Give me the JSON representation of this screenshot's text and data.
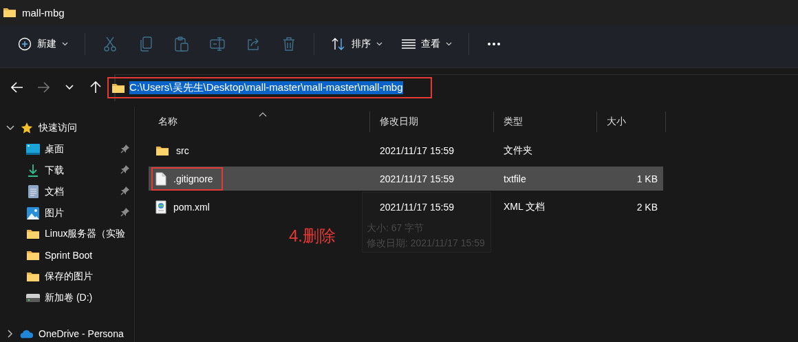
{
  "window": {
    "title": "mall-mbg"
  },
  "toolbar": [
    {
      "kind": "new",
      "label": "新建",
      "disabled": false
    },
    {
      "kind": "cut",
      "disabled": true
    },
    {
      "kind": "copy",
      "disabled": true
    },
    {
      "kind": "paste",
      "disabled": true
    },
    {
      "kind": "rename",
      "disabled": true
    },
    {
      "kind": "share",
      "disabled": true
    },
    {
      "kind": "delete",
      "disabled": true
    },
    {
      "kind": "sort",
      "label": "排序",
      "disabled": false
    },
    {
      "kind": "view",
      "label": "查看",
      "disabled": false
    },
    {
      "kind": "more",
      "disabled": false
    }
  ],
  "nav": {
    "back_disabled": false,
    "forward_disabled": true,
    "address": {
      "path": "C:\\Users\\吴先生\\Desktop\\mall-master\\mall-master\\mall-mbg",
      "selected": true,
      "marked": true
    }
  },
  "sidebar": {
    "items": [
      {
        "kind": "star",
        "label": "快速访问",
        "expanded": true,
        "children": [
          {
            "kind": "desktop",
            "label": "桌面",
            "pinned": true
          },
          {
            "kind": "download",
            "label": "下载",
            "pinned": true
          },
          {
            "kind": "document",
            "label": "文档",
            "pinned": true
          },
          {
            "kind": "pictures",
            "label": "图片",
            "pinned": true
          },
          {
            "kind": "folder",
            "label": "Linux服务器（实验",
            "pinned": false
          },
          {
            "kind": "folder",
            "label": "Sprint Boot",
            "pinned": false
          },
          {
            "kind": "folder",
            "label": "保存的图片",
            "pinned": false
          },
          {
            "kind": "drive",
            "label": "新加卷 (D:)",
            "pinned": false
          }
        ]
      },
      {
        "kind": "cloud",
        "label": "OneDrive - Persona",
        "expanded": false
      }
    ]
  },
  "table": {
    "columns": [
      {
        "label": "名称",
        "sorted": true
      },
      {
        "label": "修改日期",
        "sorted": false
      },
      {
        "label": "类型",
        "sorted": false
      },
      {
        "label": "大小",
        "sorted": false
      }
    ],
    "rows": [
      {
        "kind": "folder",
        "name": "src",
        "modified": "2021/11/17 15:59",
        "type": "文件夹",
        "size": "",
        "selected": false,
        "marked": false
      },
      {
        "kind": "text",
        "name": ".gitignore",
        "modified": "2021/11/17 15:59",
        "type": "txtfile",
        "size": "1 KB",
        "selected": true,
        "marked": true
      },
      {
        "kind": "xml",
        "name": "pom.xml",
        "modified": "2021/11/17 15:59",
        "type": "XML 文档",
        "size": "2 KB",
        "selected": false,
        "marked": false
      }
    ]
  },
  "tooltip": {
    "lines": [
      "大小: 67 字节",
      "修改日期: 2021/11/17 15:59"
    ]
  },
  "annotation": {
    "text": "4.删除"
  }
}
